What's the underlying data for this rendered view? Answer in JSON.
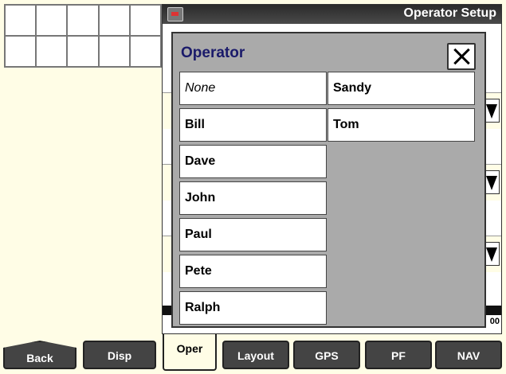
{
  "window": {
    "title": "Operator Setup"
  },
  "modal": {
    "title": "Operator",
    "close_label": "Close",
    "options": [
      "None",
      "Bill",
      "Dave",
      "John",
      "Paul",
      "Pete",
      "Ralph",
      "Sandy",
      "Tom"
    ]
  },
  "background": {
    "value_fragment": "00"
  },
  "tabs": [
    {
      "label": "Back"
    },
    {
      "label": "Disp"
    },
    {
      "label": "Oper",
      "active": true
    },
    {
      "label": "Layout"
    },
    {
      "label": "GPS"
    },
    {
      "label": "PF"
    },
    {
      "label": "NAV"
    }
  ]
}
